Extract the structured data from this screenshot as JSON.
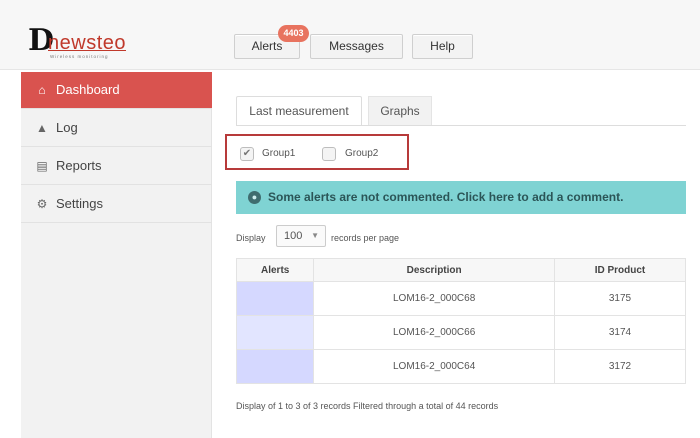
{
  "logo": {
    "mark": "D",
    "name": "newsteo",
    "tagline": "Wireless monitoring"
  },
  "header": {
    "alerts_label": "Alerts",
    "alerts_badge": "4403",
    "messages_label": "Messages",
    "help_label": "Help"
  },
  "sidebar": {
    "items": [
      {
        "label": "Dashboard",
        "icon": "home-icon",
        "glyph": "⌂"
      },
      {
        "label": "Log",
        "icon": "log-icon",
        "glyph": "▲"
      },
      {
        "label": "Reports",
        "icon": "reports-icon",
        "glyph": "▤"
      },
      {
        "label": "Settings",
        "icon": "settings-icon",
        "glyph": "⚙"
      }
    ]
  },
  "tabs": [
    {
      "label": "Last measurement"
    },
    {
      "label": "Graphs"
    }
  ],
  "groups": [
    {
      "label": "Group1",
      "checked": true,
      "glyph": "✔"
    },
    {
      "label": "Group2",
      "checked": false,
      "glyph": ""
    }
  ],
  "banner": {
    "icon_glyph": "●",
    "text": "Some alerts are not commented. Click here to add a comment."
  },
  "pagination": {
    "display_label": "Display",
    "per_page_value": "100",
    "caret": "▼",
    "records_label": "records per page"
  },
  "table": {
    "headers": [
      "Alerts",
      "Description",
      "ID Product"
    ],
    "rows": [
      {
        "description": "LOM16-2_000C68",
        "id": "3175"
      },
      {
        "description": "LOM16-2_000C66",
        "id": "3174"
      },
      {
        "description": "LOM16-2_000C64",
        "id": "3172"
      }
    ]
  },
  "footer": "Display of 1 to 3 of 3 records Filtered through a total of 44 records",
  "colors": {
    "accent": "#d9534f",
    "banner": "#7fd3d3",
    "alert_cell": "#d5d8ff"
  }
}
